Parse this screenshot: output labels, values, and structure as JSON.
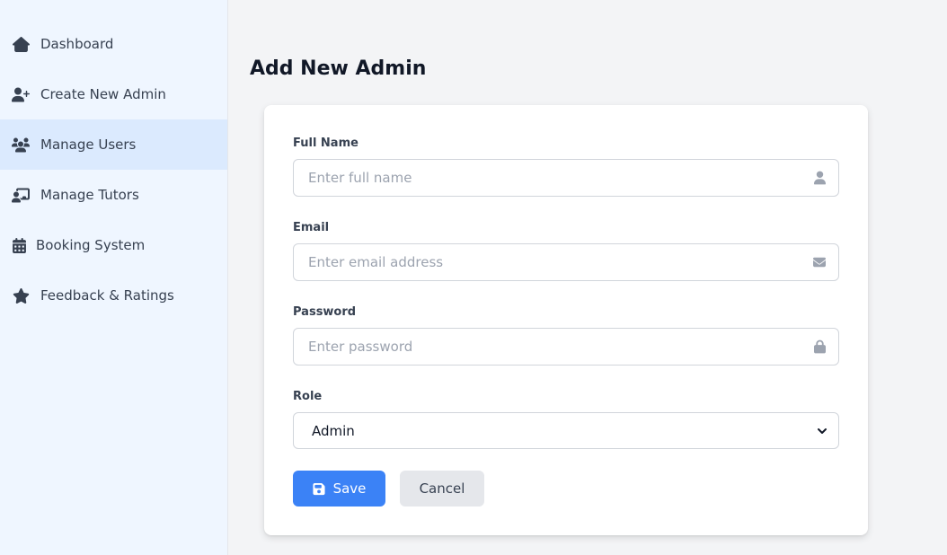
{
  "sidebar": {
    "items": [
      {
        "label": "Dashboard",
        "icon": "home-icon",
        "active": false
      },
      {
        "label": "Create New Admin",
        "icon": "user-plus-icon",
        "active": false
      },
      {
        "label": "Manage Users",
        "icon": "users-icon",
        "active": true
      },
      {
        "label": "Manage Tutors",
        "icon": "chalkboard-teacher-icon",
        "active": false
      },
      {
        "label": "Booking System",
        "icon": "calendar-icon",
        "active": false
      },
      {
        "label": "Feedback & Ratings",
        "icon": "star-icon",
        "active": false
      }
    ]
  },
  "page": {
    "title": "Add New Admin"
  },
  "form": {
    "full_name": {
      "label": "Full Name",
      "placeholder": "Enter full name",
      "value": "",
      "icon": "user-icon"
    },
    "email": {
      "label": "Email",
      "placeholder": "Enter email address",
      "value": "",
      "icon": "envelope-icon"
    },
    "password": {
      "label": "Password",
      "placeholder": "Enter password",
      "value": "",
      "icon": "lock-icon"
    },
    "role": {
      "label": "Role",
      "selected": "Admin"
    },
    "save_label": "Save",
    "cancel_label": "Cancel"
  },
  "colors": {
    "accent": "#3b82f6",
    "sidebar_bg": "#eff6ff",
    "sidebar_active": "#dbeafe",
    "page_bg": "#f3f4f6"
  }
}
